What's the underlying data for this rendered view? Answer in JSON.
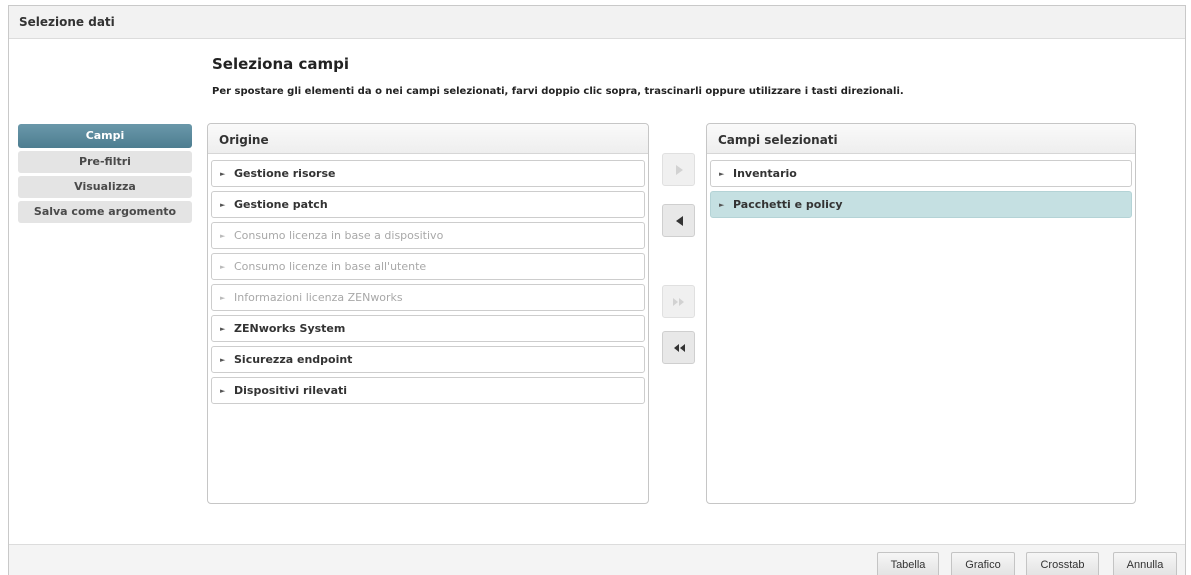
{
  "window": {
    "title": "Selezione dati"
  },
  "header": {
    "title": "Seleziona campi",
    "instructions": "Per spostare gli elementi da o nei campi selezionati, farvi doppio clic sopra, trascinarli oppure utilizzare i tasti direzionali."
  },
  "nav": {
    "items": [
      {
        "label": "Campi",
        "active": true
      },
      {
        "label": "Pre-filtri",
        "active": false
      },
      {
        "label": "Visualizza",
        "active": false
      },
      {
        "label": "Salva come argomento",
        "active": false
      }
    ]
  },
  "source": {
    "title": "Origine",
    "items": [
      {
        "label": "Gestione risorse",
        "enabled": true
      },
      {
        "label": "Gestione patch",
        "enabled": true
      },
      {
        "label": "Consumo licenza in base a dispositivo",
        "enabled": false
      },
      {
        "label": "Consumo licenze in base all'utente",
        "enabled": false
      },
      {
        "label": "Informazioni licenza ZENworks",
        "enabled": false
      },
      {
        "label": "ZENworks System",
        "enabled": true
      },
      {
        "label": "Sicurezza endpoint",
        "enabled": true
      },
      {
        "label": "Dispositivi rilevati",
        "enabled": true
      }
    ]
  },
  "selected": {
    "title": "Campi selezionati",
    "items": [
      {
        "label": "Inventario",
        "selected": false
      },
      {
        "label": "Pacchetti e policy",
        "selected": true
      }
    ]
  },
  "movers": {
    "add": {
      "icon": "arrow-right-icon",
      "enabled": false
    },
    "remove": {
      "icon": "arrow-left-icon",
      "enabled": true
    },
    "add_all": {
      "icon": "double-arrow-right-icon",
      "enabled": false
    },
    "remove_all": {
      "icon": "double-arrow-left-icon",
      "enabled": true
    }
  },
  "footer": {
    "table_label": "Tabella",
    "chart_label": "Grafico",
    "crosstab_label": "Crosstab",
    "cancel_label": "Annulla"
  },
  "colors": {
    "accent": "#5a889b",
    "selected_row": "#c5e0e2"
  }
}
